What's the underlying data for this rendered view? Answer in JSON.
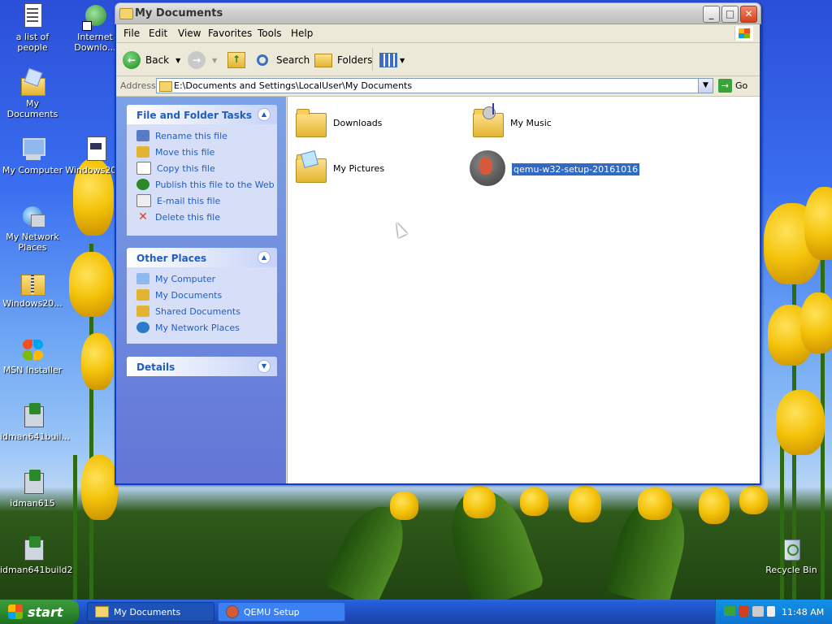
{
  "desktop": {
    "icons": [
      {
        "label": "a list of people",
        "icon": "text-document-icon"
      },
      {
        "label": "Internet Downlo...",
        "icon": "internet-download-manager-icon"
      },
      {
        "label": "My Documents",
        "icon": "my-documents-icon"
      },
      {
        "label": "My Computer",
        "icon": "my-computer-icon"
      },
      {
        "label": "Windows20...",
        "icon": "document-icon"
      },
      {
        "label": "My Network Places",
        "icon": "network-places-icon"
      },
      {
        "label": "Windows20...",
        "icon": "zip-folder-icon"
      },
      {
        "label": "MSN Installer",
        "icon": "msn-butterfly-icon"
      },
      {
        "label": "idman641buil...",
        "icon": "installer-icon"
      },
      {
        "label": "idman615",
        "icon": "installer-icon"
      },
      {
        "label": "idman641build2",
        "icon": "installer-icon"
      },
      {
        "label": "Recycle Bin",
        "icon": "recycle-bin-icon"
      }
    ]
  },
  "window": {
    "title": "My Documents",
    "menu": [
      "File",
      "Edit",
      "View",
      "Favorites",
      "Tools",
      "Help"
    ],
    "toolbar": {
      "back": "Back",
      "search": "Search",
      "folders": "Folders"
    },
    "address": {
      "label": "Address",
      "value": "E:\\Documents and Settings\\LocalUser\\My Documents",
      "go": "Go"
    },
    "taskpane": {
      "file_tasks": {
        "title": "File and Folder Tasks",
        "items": [
          "Rename this file",
          "Move this file",
          "Copy this file",
          "Publish this file to the Web",
          "E-mail this file",
          "Delete this file"
        ]
      },
      "other_places": {
        "title": "Other Places",
        "items": [
          "My Computer",
          "My Documents",
          "Shared Documents",
          "My Network Places"
        ]
      },
      "details": {
        "title": "Details"
      }
    },
    "files": [
      {
        "name": "Downloads",
        "icon": "folder-icon"
      },
      {
        "name": "My Music",
        "icon": "music-folder-icon"
      },
      {
        "name": "My Pictures",
        "icon": "pictures-folder-icon"
      },
      {
        "name": "qemu-w32-setup-20161016",
        "icon": "qemu-installer-icon",
        "selected": true
      }
    ]
  },
  "taskbar": {
    "start": "start",
    "tasks": [
      "My Documents",
      "QEMU Setup"
    ],
    "clock": "11:48 AM"
  },
  "colors": {
    "selection": "#316ac5",
    "link": "#215dc6",
    "taskbar": "#245edb",
    "start": "#2e8b2e"
  }
}
